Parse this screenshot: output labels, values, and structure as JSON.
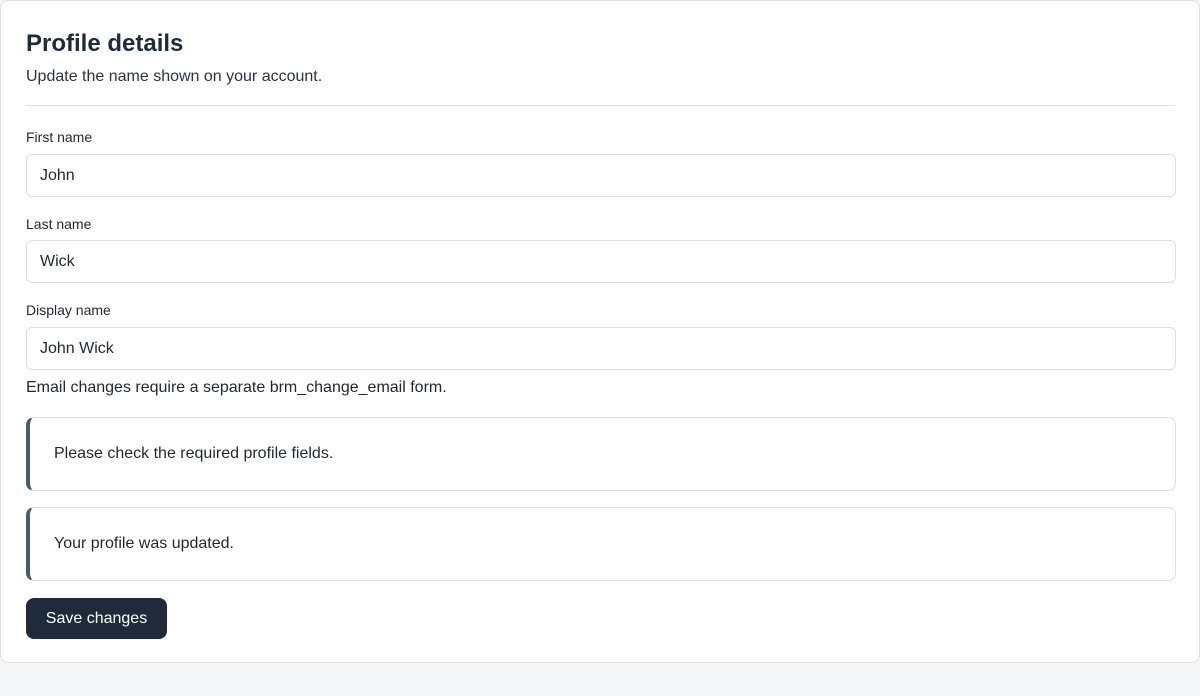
{
  "header": {
    "title": "Profile details",
    "subtitle": "Update the name shown on your account."
  },
  "form": {
    "first_name": {
      "label": "First name",
      "value": "John"
    },
    "last_name": {
      "label": "Last name",
      "value": "Wick"
    },
    "display_name": {
      "label": "Display name",
      "value": "John Wick"
    },
    "help_text": "Email changes require a separate brm_change_email form."
  },
  "notices": {
    "warning": "Please check the required profile fields.",
    "success": "Your profile was updated."
  },
  "actions": {
    "save_label": "Save changes"
  },
  "colors": {
    "primary": "#1f2a3a",
    "notice_accent": "#475b70",
    "page_background": "#f5f6f8"
  }
}
